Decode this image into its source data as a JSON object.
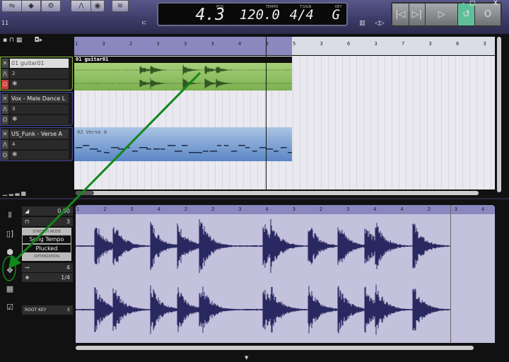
{
  "toolbar": {
    "left_label": "11",
    "icons": [
      "mixer-icon",
      "cube-icon",
      "gear-icon",
      "envelope-icon",
      "record-icon",
      "wifi-icon"
    ]
  },
  "display": {
    "pos_label": "POS",
    "pos": "4.3",
    "tempo_label": "TEMPO",
    "tempo": "120.0",
    "tsign_label": "T.SIGN",
    "tsign": "4/4",
    "key_label": "KEY",
    "key": "G"
  },
  "transport": {
    "buttons": [
      "|◁",
      "▷|",
      "▷",
      "↺",
      "O"
    ],
    "loop_active_color": "#5fbf9a"
  },
  "window": {
    "min": "-",
    "max": "□",
    "close": "X"
  },
  "arrange": {
    "ruler": [
      "1",
      "3",
      "2",
      "3",
      "3",
      "3",
      "4",
      "3",
      "5",
      "3",
      "6",
      "3",
      "7",
      "3",
      "8",
      "3"
    ],
    "tracks": [
      {
        "name": "01 guitar01",
        "number": "2",
        "record": true
      },
      {
        "name": "Vox - Male Dance L",
        "number": "3",
        "record": false
      },
      {
        "name": "US_Funk - Verse A",
        "number": "4",
        "record": false
      }
    ],
    "clips": [
      {
        "name": "01 guitar01",
        "color": "#8cc060"
      },
      {
        "name": "02 Verse A",
        "color": "#6a94cc"
      }
    ]
  },
  "editor": {
    "ruler": [
      "1",
      "2",
      "3",
      "4",
      "2",
      "2",
      "3",
      "4",
      "3",
      "2",
      "3",
      "4",
      "4",
      "2",
      "3",
      "4"
    ],
    "volume": "0.00",
    "transpose": "3",
    "stretch_mode_label": "STRETCH MODE",
    "stretch_mode": "Song Tempo",
    "optimization": "Plucked",
    "optimization_label": "OPTIMIZATION",
    "beats": "4",
    "grid": "1/4",
    "root_key_label": "ROOT KEY",
    "root_key": "E",
    "waveform_color": "#2a2860"
  },
  "annotation": {
    "arrow_color": "#11881a"
  }
}
